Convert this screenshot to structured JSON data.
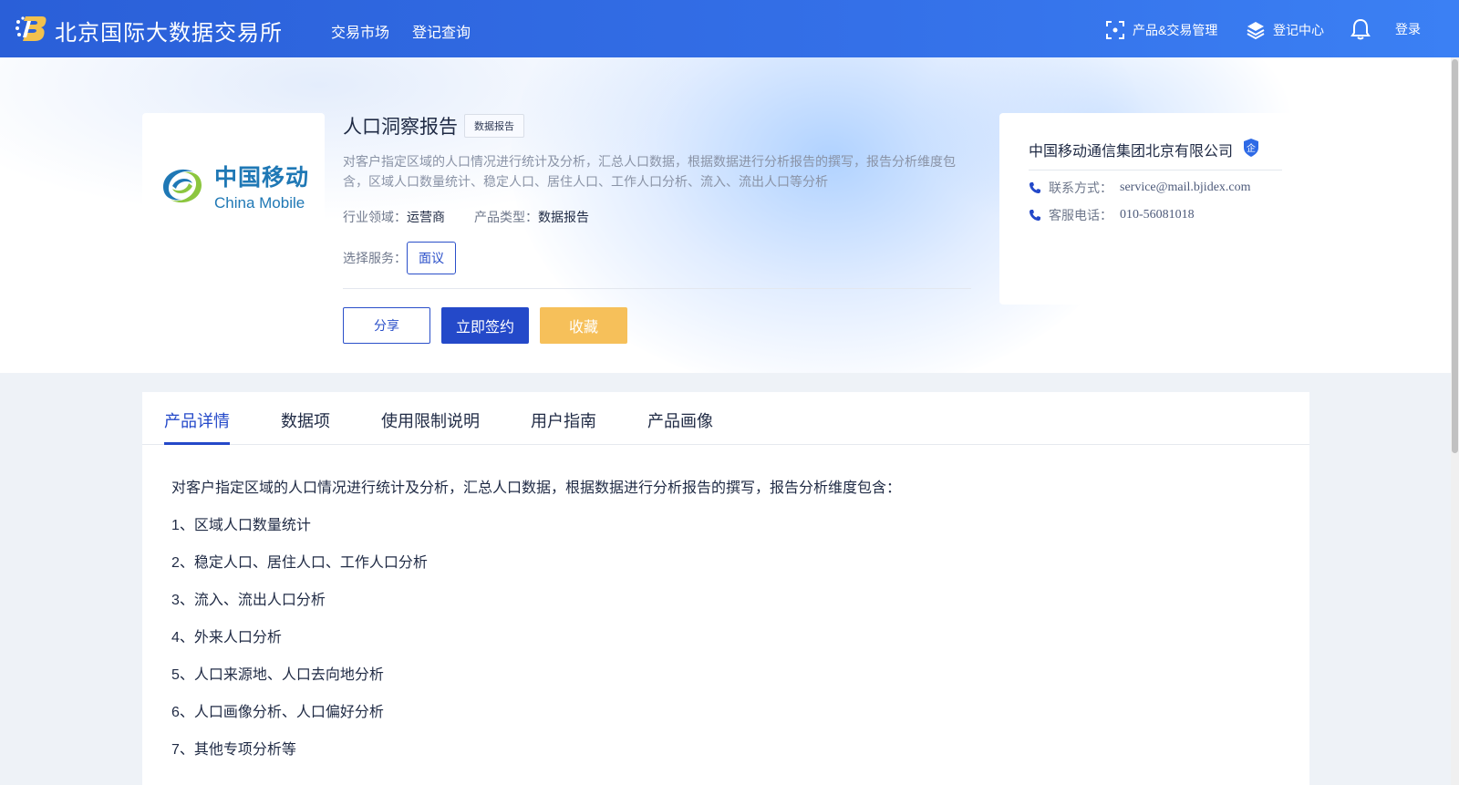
{
  "header": {
    "site_title": "北京国际大数据交易所",
    "nav": [
      {
        "label": "交易市场"
      },
      {
        "label": "登记查询"
      }
    ],
    "product_trade_mgmt": "产品&交易管理",
    "register_center": "登记中心",
    "login": "登录"
  },
  "product": {
    "title": "人口洞察报告",
    "tag": "数据报告",
    "description": "对客户指定区域的人口情况进行统计及分析，汇总人口数据，根据数据进行分析报告的撰写，报告分析维度包含，区域人口数量统计、稳定人口、居住人口、工作人口分析、流入、流出人口等分析",
    "industry_label": "行业领域：",
    "industry_value": "运营商",
    "type_label": "产品类型：",
    "type_value": "数据报告",
    "service_label": "选择服务：",
    "service_option": "面议",
    "share_label": "分享",
    "sign_label": "立即签约",
    "favorite_label": "收藏",
    "logo_cn": "中国移动",
    "logo_en": "China Mobile"
  },
  "company": {
    "name": "中国移动通信集团北京有限公司",
    "badge": "企",
    "contact_label": "联系方式：",
    "contact_value": "service@mail.bjidex.com",
    "phone_label": "客服电话：",
    "phone_value": "010-56081018"
  },
  "tabs": [
    {
      "label": "产品详情",
      "active": true
    },
    {
      "label": "数据项",
      "active": false
    },
    {
      "label": "使用限制说明",
      "active": false
    },
    {
      "label": "用户指南",
      "active": false
    },
    {
      "label": "产品画像",
      "active": false
    }
  ],
  "detail": {
    "lines": [
      "对客户指定区域的人口情况进行统计及分析，汇总人口数据，根据数据进行分析报告的撰写，报告分析维度包含：",
      "1、区域人口数量统计",
      "2、稳定人口、居住人口、工作人口分析",
      "3、流入、流出人口分析",
      "4、外来人口分析",
      "5、人口来源地、人口去向地分析",
      "6、人口画像分析、人口偏好分析",
      "7、其他专项分析等"
    ]
  },
  "colors": {
    "header_blue": "#2a5fd8",
    "primary": "#2449c9",
    "favorite": "#f6c05a"
  }
}
